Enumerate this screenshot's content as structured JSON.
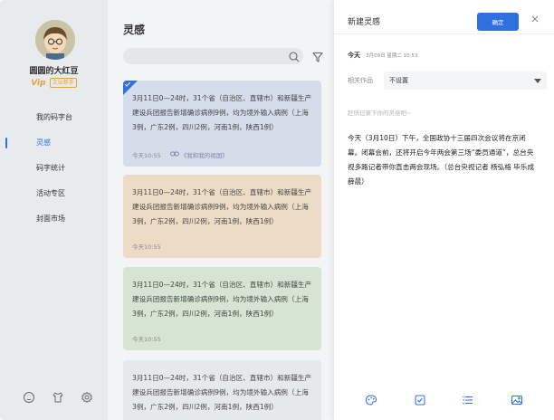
{
  "user": {
    "name": "圆圆的大红豆",
    "vip": "Vip",
    "level_badge": "文坛新手"
  },
  "nav": [
    {
      "label": "我的码字台",
      "active": false
    },
    {
      "label": "灵感",
      "active": true
    },
    {
      "label": "码字统计",
      "active": false
    },
    {
      "label": "活动专区",
      "active": false
    },
    {
      "label": "封面市场",
      "active": false
    }
  ],
  "footer_icons": [
    "help-icon",
    "shirt-icon",
    "settings-icon"
  ],
  "list": {
    "title": "灵感",
    "search_placeholder": "",
    "cards": [
      {
        "text": "3月11日0—24时，31个省（自治区、直辖市）和新疆生产建设兵团报告新增确诊病例9例，均为境外输入病例（上海3例，广东2例，四川2例，河南1例，陕西1例）",
        "time": "今天10:55",
        "link": "《我和我的祖国》",
        "color": "#d5dcea",
        "selected": true
      },
      {
        "text": "3月11日0—24时，31个省（自治区、直辖市）和新疆生产建设兵团报告新增确诊病例9例，均为境外输入病例（上海3例，广东2例，四川2例，河南1例，陕西1例）",
        "time": "今天10:55",
        "link": "",
        "color": "#ecdcc7",
        "selected": false
      },
      {
        "text": "3月11日0—24时，31个省（自治区、直辖市）和新疆生产建设兵团报告新增确诊病例9例，均为境外输入病例（上海3例，广东2例，四川2例，河南1例，陕西1例）",
        "time": "今天10:55",
        "link": "",
        "color": "#d6e5d1",
        "selected": false
      },
      {
        "text": "3月11日0—24时，31个省（自治区、直辖市）和新疆生产建设兵团报告新增确诊病例9例，均为境外输入病例（上海3例，广东2例，四川2例，河南1例，陕西1例）",
        "time": "",
        "link": "",
        "color": "#e7e8ea",
        "selected": false
      }
    ]
  },
  "panel": {
    "title": "新建灵感",
    "confirm_label": "确定",
    "date_label": "今天",
    "date_value": "3月09日 星期二 10:53",
    "work_label": "相关作品",
    "work_value": "不设置",
    "hint": "赶快记录下你的灵感吧~",
    "body": "今天（3月10日）下午，全国政协十三届四次会议将在京闭幕。闭幕会前，还将开启今年两会第三场“委员通道”，总台央视多路记者带你直击两会现场。（总台央视记者 杨弘格 毕乐成 薛晨）",
    "toolbar_icons": [
      "palette-icon",
      "checkbox-icon",
      "list-icon",
      "image-icon"
    ]
  },
  "colors": {
    "accent": "#2f6fe0",
    "sidebar_bg": "#e8eaee",
    "vip": "#e6a23c"
  }
}
